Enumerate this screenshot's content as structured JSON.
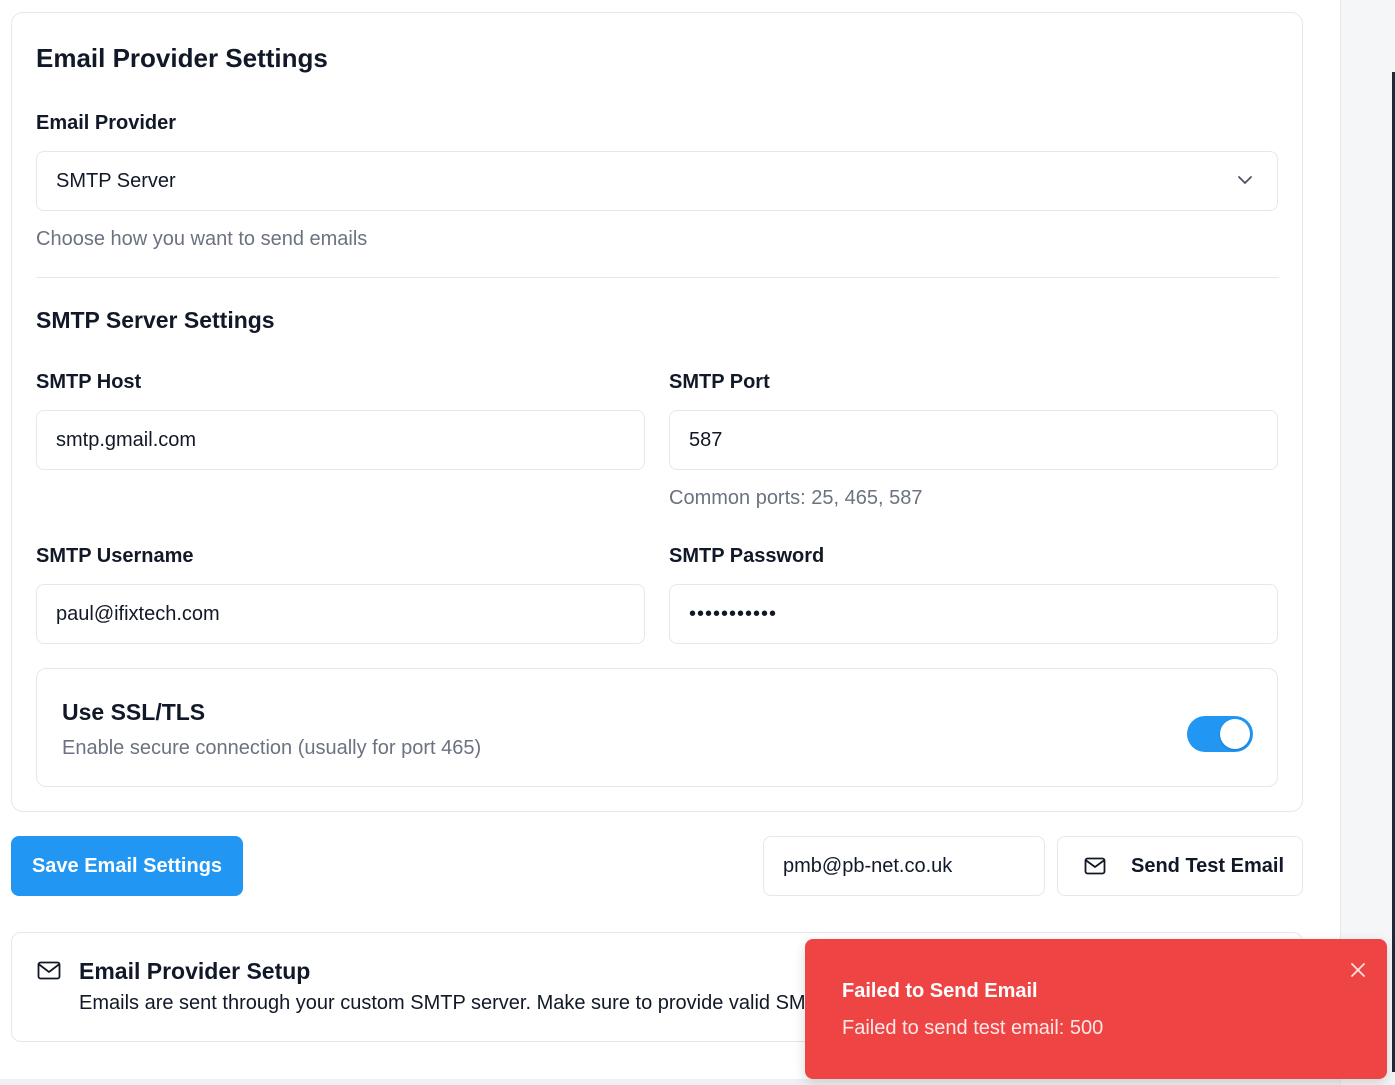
{
  "email_provider_card": {
    "title": "Email Provider Settings",
    "provider_label": "Email Provider",
    "provider_value": "SMTP Server",
    "provider_hint": "Choose how you want to send emails"
  },
  "smtp": {
    "section_title": "SMTP Server Settings",
    "host_label": "SMTP Host",
    "host_value": "smtp.gmail.com",
    "port_label": "SMTP Port",
    "port_value": "587",
    "port_hint": "Common ports: 25, 465, 587",
    "username_label": "SMTP Username",
    "username_value": "paul@ifixtech.com",
    "password_label": "SMTP Password",
    "password_masked": "•••••••••••"
  },
  "ssl": {
    "title": "Use SSL/TLS",
    "description": "Enable secure connection (usually for port 465)",
    "enabled": true
  },
  "actions": {
    "save_label": "Save Email Settings",
    "test_email_value": "pmb@pb-net.co.uk",
    "send_test_label": "Send Test Email"
  },
  "info": {
    "title": "Email Provider Setup",
    "description": "Emails are sent through your custom SMTP server. Make sure to provide valid SMTP credentials."
  },
  "toast": {
    "title": "Failed to Send Email",
    "message": "Failed to send test email: 500"
  },
  "colors": {
    "accent": "#2196f3",
    "error": "#ef4444"
  }
}
